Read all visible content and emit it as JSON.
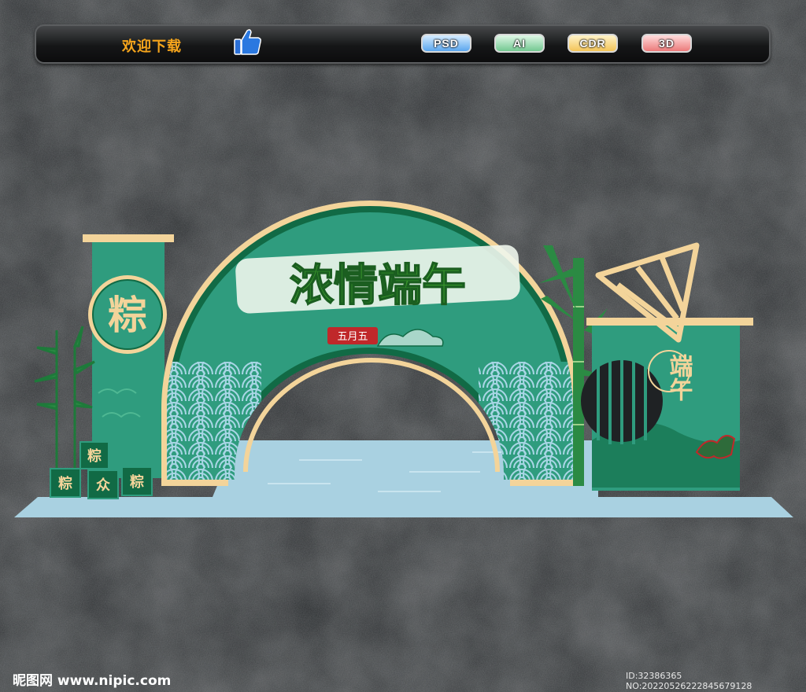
{
  "toolbar": {
    "welcome_text": "欢迎下载",
    "formats": [
      "PSD",
      "AI",
      "CDR",
      "3D"
    ]
  },
  "artwork": {
    "main_title": "浓情端午",
    "date_tag": "五月五",
    "left_medallion": "粽",
    "box_top": "粽",
    "box_left": "粽",
    "box_mid": "众",
    "box_right": "粽",
    "right_panel_text": "端午"
  },
  "footer": {
    "watermark": "昵图网 www.nipic.com",
    "id_text": "ID:32386365 NO:20220526222845679128"
  },
  "colors": {
    "teal": "#2f9c7e",
    "dark_green": "#116a45",
    "cream": "#f3d49a",
    "floor": "#a9d1e1",
    "title_green": "#3b9c2c"
  }
}
